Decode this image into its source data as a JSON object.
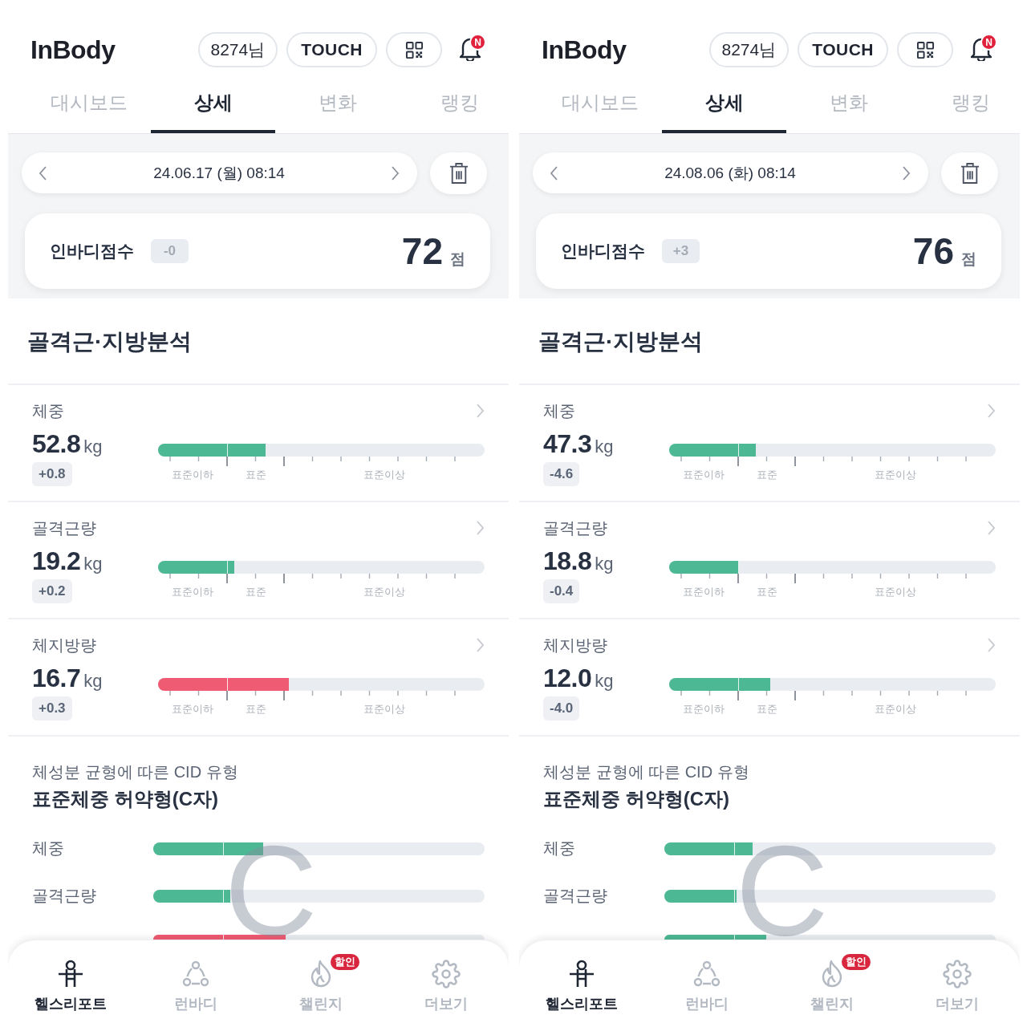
{
  "screens": [
    {
      "logo": "InBody",
      "user_chip": "8274님",
      "touch_button": "TOUCH",
      "notification_badge": "N",
      "tabs": [
        {
          "label": "대시보드",
          "selected": false
        },
        {
          "label": "상세",
          "selected": true
        },
        {
          "label": "변화",
          "selected": false
        },
        {
          "label": "랭킹",
          "selected": false
        }
      ],
      "date": "24.06.17 (월) 08:14",
      "score": {
        "label": "인바디점수",
        "change": "-0",
        "value": "72",
        "unit": "점"
      },
      "section_title": "골격근·지방분석",
      "metrics": [
        {
          "name": "체중",
          "value": "52.8",
          "unit": "kg",
          "change": "+0.8",
          "level": 0.33,
          "color": "#4cb894",
          "scale_labels": [
            "표준이하",
            "표준",
            "표준이상"
          ]
        },
        {
          "name": "골격근량",
          "value": "19.2",
          "unit": "kg",
          "change": "+0.2",
          "level": 0.233,
          "color": "#4cb894",
          "scale_labels": [
            "표준이하",
            "표준",
            "표준이상"
          ]
        },
        {
          "name": "체지방량",
          "value": "16.7",
          "unit": "kg",
          "change": "+0.3",
          "level": 0.4,
          "color": "#ef5b72",
          "scale_labels": [
            "표준이하",
            "표준",
            "표준이상"
          ]
        }
      ],
      "cid": {
        "caption": "체성분 균형에 따른 CID 유형",
        "type": "표준체중 허약형(C자)",
        "letter": "C",
        "rows": [
          {
            "label": "체중",
            "level": 0.332,
            "color": "#4cb894"
          },
          {
            "label": "골격근량",
            "level": 0.232,
            "color": "#4cb894"
          },
          {
            "level": 0.4,
            "color": "#ef5b72"
          }
        ]
      },
      "bottom_nav": [
        {
          "label": "헬스리포트",
          "selected": true
        },
        {
          "label": "런바디",
          "selected": false
        },
        {
          "label": "챌린지",
          "selected": false,
          "badge": "할인"
        },
        {
          "label": "더보기",
          "selected": false
        }
      ]
    },
    {
      "logo": "InBody",
      "user_chip": "8274님",
      "touch_button": "TOUCH",
      "notification_badge": "N",
      "tabs": [
        {
          "label": "대시보드",
          "selected": false
        },
        {
          "label": "상세",
          "selected": true
        },
        {
          "label": "변화",
          "selected": false
        },
        {
          "label": "랭킹",
          "selected": false
        }
      ],
      "date": "24.08.06 (화) 08:14",
      "score": {
        "label": "인바디점수",
        "change": "+3",
        "value": "76",
        "unit": "점"
      },
      "section_title": "골격근·지방분석",
      "metrics": [
        {
          "name": "체중",
          "value": "47.3",
          "unit": "kg",
          "change": "-4.6",
          "level": 0.265,
          "color": "#4cb894",
          "scale_labels": [
            "표준이하",
            "표준",
            "표준이상"
          ]
        },
        {
          "name": "골격근량",
          "value": "18.8",
          "unit": "kg",
          "change": "-0.4",
          "level": 0.214,
          "color": "#4cb894",
          "scale_labels": [
            "표준이하",
            "표준",
            "표준이상"
          ]
        },
        {
          "name": "체지방량",
          "value": "12.0",
          "unit": "kg",
          "change": "-4.0",
          "level": 0.31,
          "color": "#4cb894",
          "scale_labels": [
            "표준이하",
            "표준",
            "표준이상"
          ]
        }
      ],
      "cid": {
        "caption": "체성분 균형에 따른 CID 유형",
        "type": "표준체중 허약형(C자)",
        "letter": "C",
        "rows": [
          {
            "label": "체중",
            "level": 0.266,
            "color": "#4cb894"
          },
          {
            "label": "골격근량",
            "level": 0.218,
            "color": "#4cb894"
          },
          {
            "level": 0.307,
            "color": "#4cb894"
          }
        ]
      },
      "bottom_nav": [
        {
          "label": "헬스리포트",
          "selected": true
        },
        {
          "label": "런바디",
          "selected": false
        },
        {
          "label": "챌린지",
          "selected": false,
          "badge": "할인"
        },
        {
          "label": "더보기",
          "selected": false
        }
      ]
    }
  ]
}
